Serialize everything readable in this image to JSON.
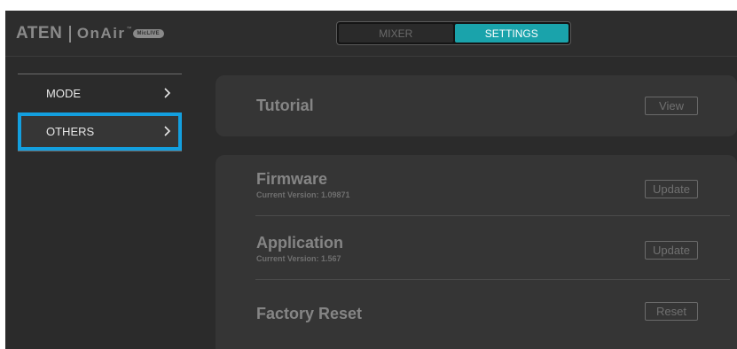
{
  "header": {
    "logo": {
      "brand": "ATEN",
      "product": "OnAir",
      "trademark": "™",
      "badge": "MicLIVE"
    },
    "tabs": [
      {
        "label": "MIXER",
        "active": false
      },
      {
        "label": "SETTINGS",
        "active": true
      }
    ]
  },
  "sidebar": {
    "items": [
      {
        "label": "MODE",
        "icon": "chevron-right-icon",
        "selected": false
      },
      {
        "label": "OTHERS",
        "icon": "chevron-right-icon",
        "selected": true
      }
    ]
  },
  "main": {
    "tutorial": {
      "title": "Tutorial",
      "button": "View"
    },
    "firmware": {
      "title": "Firmware",
      "subtitle": "Current Version: 1.09871",
      "button": "Update"
    },
    "application": {
      "title": "Application",
      "subtitle": "Current Version: 1.567",
      "button": "Update"
    },
    "factory_reset": {
      "title": "Factory Reset",
      "button": "Reset"
    }
  },
  "colors": {
    "accent_teal": "#1aa3ab",
    "selection_blue": "#139fdf",
    "background": "#2b2b2b",
    "card": "#353535"
  }
}
